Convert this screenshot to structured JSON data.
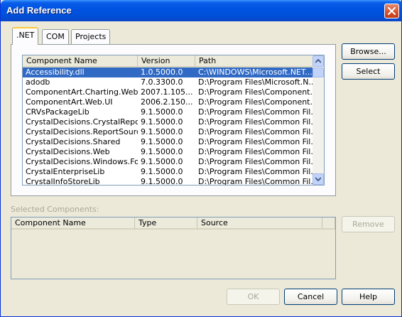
{
  "window": {
    "title": "Add Reference"
  },
  "tabs": [
    {
      "label": ".NET",
      "active": true
    },
    {
      "label": "COM",
      "active": false
    },
    {
      "label": "Projects",
      "active": false
    }
  ],
  "references": {
    "columns": [
      "Component Name",
      "Version",
      "Path"
    ],
    "rows": [
      [
        "Accessibility.dll",
        "1.0.5000.0",
        "C:\\WINDOWS\\Microsoft.NET..."
      ],
      [
        "adodb",
        "7.0.3300.0",
        "D:\\Program Files\\Microsoft.N..."
      ],
      [
        "ComponentArt.Charting.Web...",
        "2007.1.105...",
        "D:\\Program Files\\Component..."
      ],
      [
        "ComponentArt.Web.UI",
        "2006.2.150...",
        "D:\\Program Files\\Component..."
      ],
      [
        "CRVsPackageLib",
        "9.1.5000.0",
        "D:\\Program Files\\Common Fil..."
      ],
      [
        "CrystalDecisions.CrystalRepo...",
        "9.1.5000.0",
        "D:\\Program Files\\Common Fil..."
      ],
      [
        "CrystalDecisions.ReportSource",
        "9.1.5000.0",
        "D:\\Program Files\\Common Fil..."
      ],
      [
        "CrystalDecisions.Shared",
        "9.1.5000.0",
        "D:\\Program Files\\Common Fil..."
      ],
      [
        "CrystalDecisions.Web",
        "9.1.5000.0",
        "D:\\Program Files\\Common Fil..."
      ],
      [
        "CrystalDecisions.Windows.Fo...",
        "9.1.5000.0",
        "D:\\Program Files\\Common Fil..."
      ],
      [
        "CrystalEnterpriseLib",
        "9.1.5000.0",
        "D:\\Program Files\\Common Fil..."
      ],
      [
        "CrystalInfoStoreLib",
        "9.1.5000.0",
        "D:\\Program Files\\Common Fil..."
      ]
    ],
    "selected_index": 0
  },
  "buttons": {
    "browse": "Browse...",
    "select": "Select",
    "remove": "Remove",
    "ok": "OK",
    "cancel": "Cancel",
    "help": "Help"
  },
  "selected_components": {
    "label": "Selected Components:",
    "columns": [
      "Component Name",
      "Type",
      "Source"
    ]
  },
  "colors": {
    "titlebar": "#0054E3",
    "selection": "#316AC5",
    "dialog_bg": "#ECE9D8"
  }
}
